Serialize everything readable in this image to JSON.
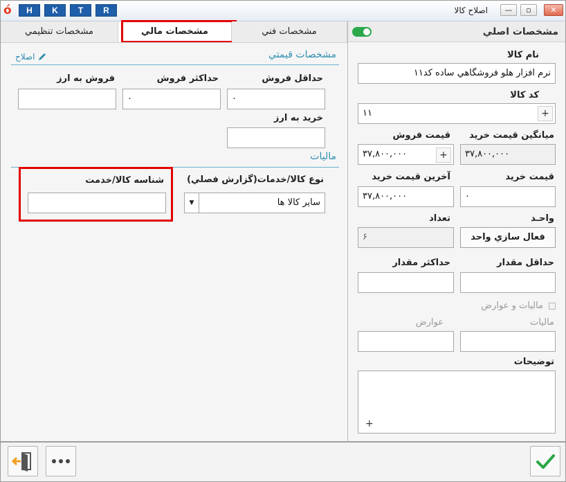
{
  "window": {
    "title": "اصلاح کالا",
    "hotkeys": [
      "H",
      "K",
      "T",
      "R"
    ],
    "controls": {
      "minimize": "—",
      "maximize": "▫",
      "close": "✕"
    }
  },
  "left_tabs": [
    {
      "label": "مشخصات تنظيمي"
    },
    {
      "label": "مشخصات مالي"
    },
    {
      "label": "مشخصات فني"
    }
  ],
  "right_panel": {
    "header": "مشخصات اصلي",
    "name_label": "نام کالا",
    "name_value": "نرم افزار هلو فروشگاهي ساده کد۱۱",
    "code_label": "کد کالا",
    "code_value": "۱۱",
    "avg_buy_label": "ميانگين قيمت خريد",
    "avg_buy_value": "۳۷,۸۰۰,۰۰۰",
    "sell_price_label": "قيمت فروش",
    "sell_price_value": "۳۷,۸۰۰,۰۰۰",
    "buy_price_label": "قيمت خريد",
    "buy_price_value": "۰",
    "last_buy_label": "آخرين قيمت خريد",
    "last_buy_value": "۳۷,۸۰۰,۰۰۰",
    "unit_label": "واحـد",
    "unit_button": "فعال سازي واحد",
    "count_label": "تعداد",
    "count_value": "۶",
    "min_qty_label": "حداقل مقدار",
    "max_qty_label": "حداکثر مقدار",
    "tax_checkbox_label": "ماليات و عوارض",
    "tax_label": "ماليات",
    "duty_label": "عوارض",
    "desc_label": "توضيحات",
    "plus": "+"
  },
  "price_section": {
    "title": "مشخصات قيمتي",
    "edit_link": "اصلاح",
    "min_sell_label": "حداقل فروش",
    "min_sell_value": "۰",
    "max_sell_label": "حداکثر فروش",
    "max_sell_value": "۰",
    "currency_sell_label": "فروش به ارز",
    "currency_buy_label": "خريد به ارز"
  },
  "tax_section": {
    "title": "ماليات",
    "type_label": "نوع کالا/خدمات(گزارش فصلي)",
    "type_value": "ساير کالا ها",
    "id_label": "شناسه کالا/خدمت"
  },
  "colors": {
    "accent": "#2d8fb0",
    "highlight": "#e20000",
    "toggle": "#2aa84a",
    "ok": "#28a745",
    "exit": "#f0a020"
  },
  "icons": {
    "edit": "pencil-icon",
    "exit": "exit-door-icon",
    "more": "more-dots-icon",
    "ok": "checkmark-icon"
  }
}
